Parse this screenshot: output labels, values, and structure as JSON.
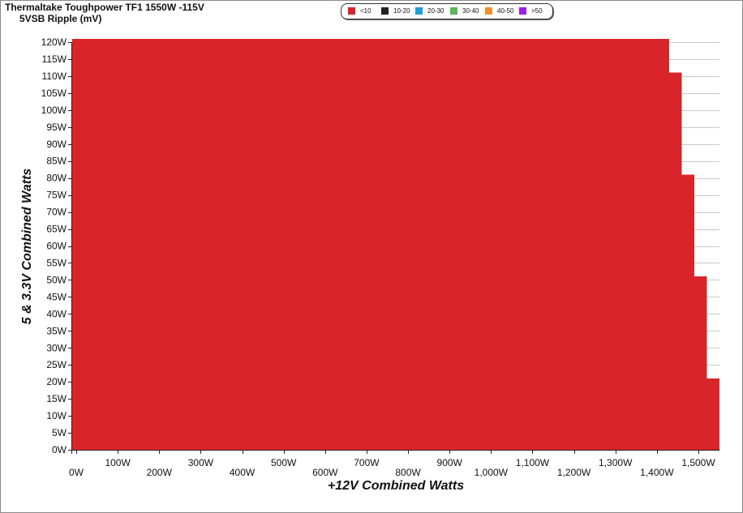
{
  "chart_data": {
    "type": "heatmap",
    "title": "Thermaltake Toughpower TF1 1550W -115V",
    "subtitle": "5VSB Ripple (mV)",
    "xlabel": "+12V Combined Watts",
    "ylabel": "5 & 3.3V Combined Watts",
    "x_ticks": [
      "0W",
      "100W",
      "200W",
      "300W",
      "400W",
      "500W",
      "600W",
      "700W",
      "800W",
      "900W",
      "1,000W",
      "1,100W",
      "1,200W",
      "1,300W",
      "1,400W",
      "1,500W"
    ],
    "y_ticks": [
      "0W",
      "5W",
      "10W",
      "15W",
      "20W",
      "25W",
      "30W",
      "35W",
      "40W",
      "45W",
      "50W",
      "55W",
      "60W",
      "65W",
      "70W",
      "75W",
      "80W",
      "85W",
      "90W",
      "95W",
      "100W",
      "105W",
      "110W",
      "115W",
      "120W"
    ],
    "xlim": [
      0,
      1550
    ],
    "ylim": [
      0,
      120
    ],
    "legend": [
      {
        "label": "<10",
        "color": "#d9252a"
      },
      {
        "label": "10-20",
        "color": "#222222"
      },
      {
        "label": "20-30",
        "color": "#1e9fd6"
      },
      {
        "label": "30-40",
        "color": "#5cb85c"
      },
      {
        "label": "40-50",
        "color": "#f0922b"
      },
      {
        "label": ">50",
        "color": "#9b1fe8"
      }
    ],
    "legend_position": "top-center",
    "grid": true,
    "regions": [
      {
        "band": "<10",
        "y_from": 0,
        "y_to": 21,
        "x_max": 1550
      },
      {
        "band": "<10",
        "y_from": 21,
        "y_to": 51,
        "x_max": 1520
      },
      {
        "band": "<10",
        "y_from": 51,
        "y_to": 81,
        "x_max": 1490
      },
      {
        "band": "<10",
        "y_from": 81,
        "y_to": 111,
        "x_max": 1460
      },
      {
        "band": "<10",
        "y_from": 111,
        "y_to": 121,
        "x_max": 1430
      }
    ]
  }
}
